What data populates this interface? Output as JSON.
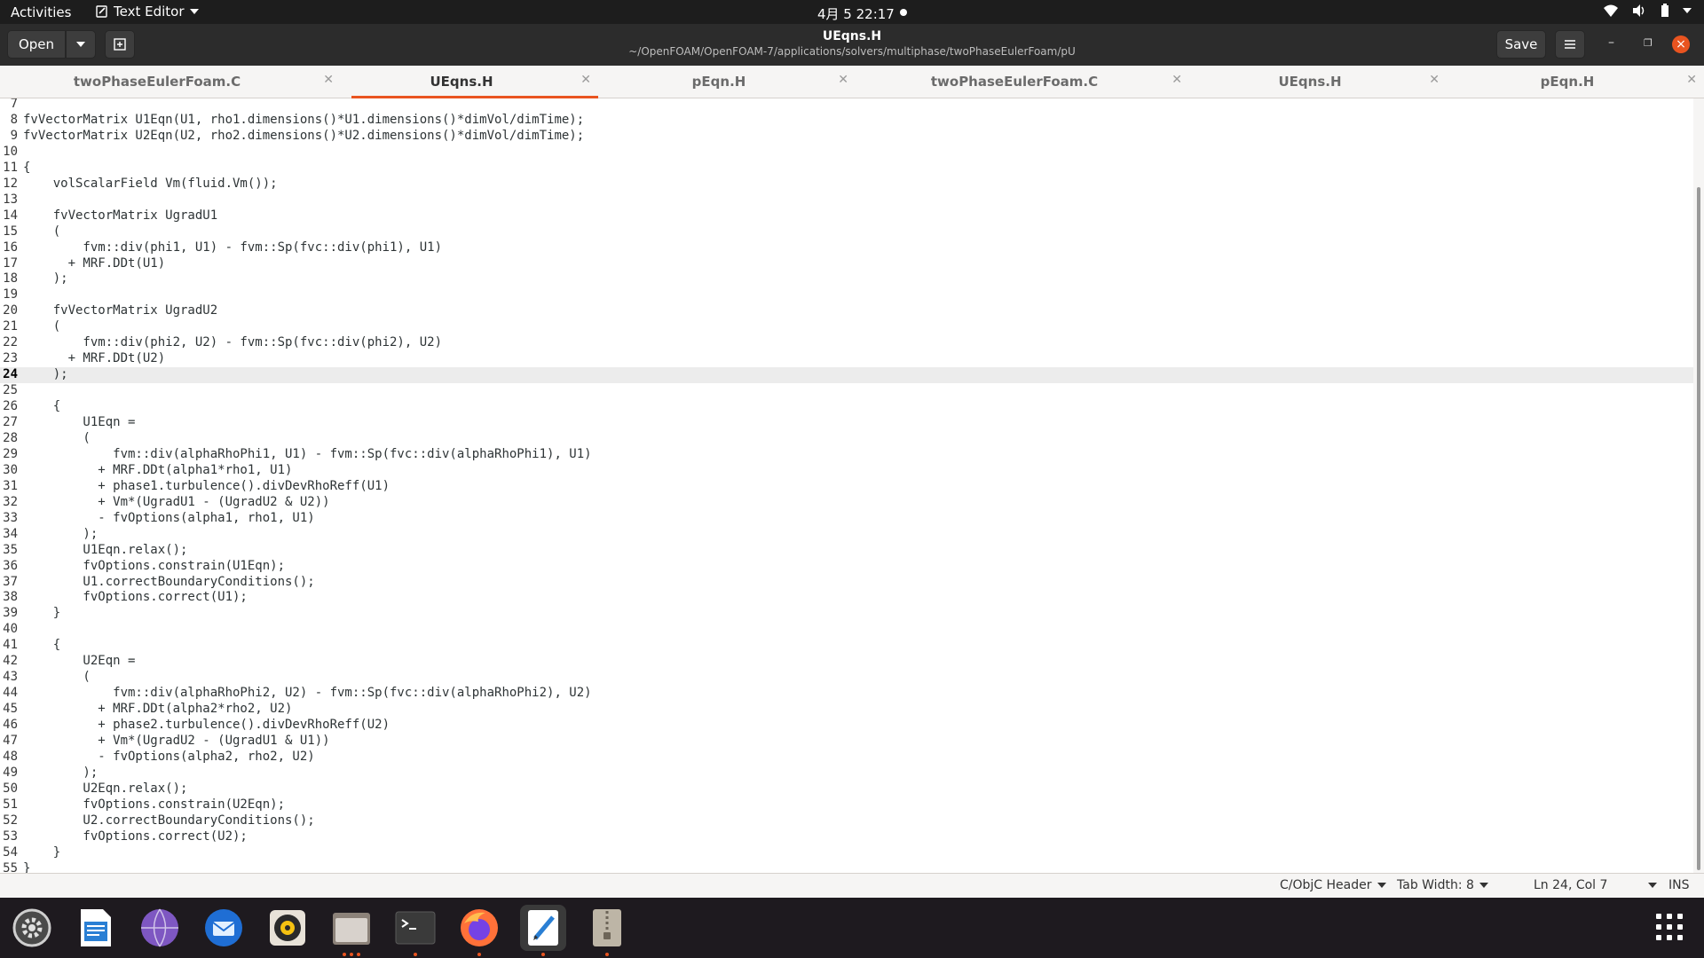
{
  "topbar": {
    "activities": "Activities",
    "app_name": "Text Editor",
    "clock": "4月 5  22:17"
  },
  "header": {
    "open_label": "Open",
    "title": "UEqns.H",
    "subtitle": "~/OpenFOAM/OpenFOAM-7/applications/solvers/multiphase/twoPhaseEulerFoam/pU",
    "save_label": "Save"
  },
  "tabs": [
    {
      "label": "twoPhaseEulerFoam.C",
      "active": false
    },
    {
      "label": "UEqns.H",
      "active": true
    },
    {
      "label": "pEqn.H",
      "active": false
    },
    {
      "label": "twoPhaseEulerFoam.C",
      "active": false
    },
    {
      "label": "UEqns.H",
      "active": false
    },
    {
      "label": "pEqn.H",
      "active": false
    }
  ],
  "editor": {
    "current_line": 24,
    "first_line": 7,
    "lines": [
      "",
      "fvVectorMatrix U1Eqn(U1, rho1.dimensions()*U1.dimensions()*dimVol/dimTime);",
      "fvVectorMatrix U2Eqn(U2, rho2.dimensions()*U2.dimensions()*dimVol/dimTime);",
      "",
      "{",
      "    volScalarField Vm(fluid.Vm());",
      "",
      "    fvVectorMatrix UgradU1",
      "    (",
      "        fvm::div(phi1, U1) - fvm::Sp(fvc::div(phi1), U1)",
      "      + MRF.DDt(U1)",
      "    );",
      "",
      "    fvVectorMatrix UgradU2",
      "    (",
      "        fvm::div(phi2, U2) - fvm::Sp(fvc::div(phi2), U2)",
      "      + MRF.DDt(U2)",
      "    );",
      "",
      "    {",
      "        U1Eqn =",
      "        (",
      "            fvm::div(alphaRhoPhi1, U1) - fvm::Sp(fvc::div(alphaRhoPhi1), U1)",
      "          + MRF.DDt(alpha1*rho1, U1)",
      "          + phase1.turbulence().divDevRhoReff(U1)",
      "          + Vm*(UgradU1 - (UgradU2 & U2))",
      "          - fvOptions(alpha1, rho1, U1)",
      "        );",
      "        U1Eqn.relax();",
      "        fvOptions.constrain(U1Eqn);",
      "        U1.correctBoundaryConditions();",
      "        fvOptions.correct(U1);",
      "    }",
      "",
      "    {",
      "        U2Eqn =",
      "        (",
      "            fvm::div(alphaRhoPhi2, U2) - fvm::Sp(fvc::div(alphaRhoPhi2), U2)",
      "          + MRF.DDt(alpha2*rho2, U2)",
      "          + phase2.turbulence().divDevRhoReff(U2)",
      "          + Vm*(UgradU2 - (UgradU1 & U1))",
      "          - fvOptions(alpha2, rho2, U2)",
      "        );",
      "        U2Eqn.relax();",
      "        fvOptions.constrain(U2Eqn);",
      "        U2.correctBoundaryConditions();",
      "        fvOptions.correct(U2);",
      "    }",
      "}"
    ]
  },
  "status": {
    "language": "C/ObjC Header",
    "tab_width": "Tab Width: 8",
    "position": "Ln 24, Col 7",
    "mode": "INS"
  },
  "dock": [
    {
      "name": "settings-icon",
      "active": false,
      "dots": 0
    },
    {
      "name": "writer-icon",
      "active": false,
      "dots": 0
    },
    {
      "name": "browser-globe-icon",
      "active": false,
      "dots": 0
    },
    {
      "name": "thunderbird-icon",
      "active": false,
      "dots": 0
    },
    {
      "name": "rhythmbox-icon",
      "active": false,
      "dots": 0
    },
    {
      "name": "files-icon",
      "active": false,
      "dots": 3
    },
    {
      "name": "terminal-icon",
      "active": false,
      "dots": 1
    },
    {
      "name": "firefox-icon",
      "active": false,
      "dots": 1
    },
    {
      "name": "text-editor-icon",
      "active": true,
      "dots": 1
    },
    {
      "name": "archive-icon",
      "active": false,
      "dots": 1
    }
  ],
  "colors": {
    "accent": "#e95420",
    "topbar": "#1d1d1d",
    "header": "#2c2c2c",
    "dock": "#1e1a1f"
  }
}
